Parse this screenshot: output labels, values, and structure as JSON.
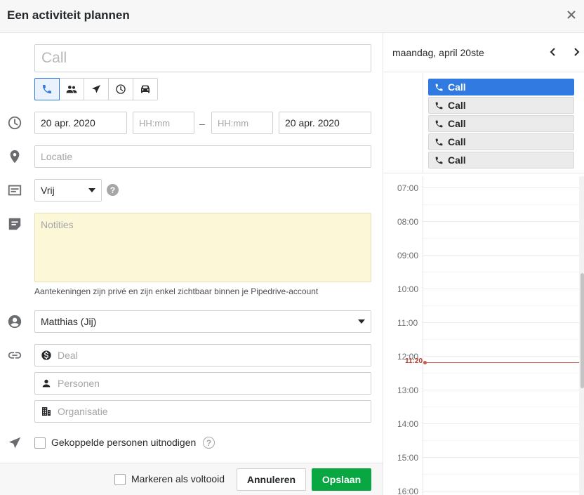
{
  "header": {
    "title": "Een activiteit plannen"
  },
  "form": {
    "subject_placeholder": "Call",
    "activity_types": [
      "call-icon",
      "meeting-icon",
      "task-icon",
      "deadline-icon",
      "lunch-icon"
    ],
    "start_date": "20 apr. 2020",
    "start_time_placeholder": "HH:mm",
    "separator": "–",
    "end_time_placeholder": "HH:mm",
    "end_date": "20 apr. 2020",
    "location_placeholder": "Locatie",
    "availability": "Vrij",
    "help_mark": "?",
    "notes_placeholder": "Notities",
    "notes_hint": "Aantekeningen zijn privé en zijn enkel zichtbaar binnen je Pipedrive-account",
    "owner": "Matthias (Jij)",
    "deal_placeholder": "Deal",
    "persons_placeholder": "Personen",
    "organization_placeholder": "Organisatie",
    "invite_label": "Gekoppelde personen uitnodigen"
  },
  "footer": {
    "mark_done_label": "Markeren als voltooid",
    "cancel_label": "Annuleren",
    "save_label": "Opslaan"
  },
  "calendar": {
    "date_label": "maandag, april 20ste",
    "events": [
      {
        "label": "Call",
        "active": true
      },
      {
        "label": "Call",
        "active": false
      },
      {
        "label": "Call",
        "active": false
      },
      {
        "label": "Call",
        "active": false
      },
      {
        "label": "Call",
        "active": false
      }
    ],
    "hours": [
      "07:00",
      "08:00",
      "09:00",
      "10:00",
      "11:00",
      "12:00",
      "13:00",
      "14:00",
      "15:00",
      "16:00"
    ],
    "now_label": "11:20"
  },
  "colors": {
    "primary": "#08a742",
    "accent": "#317ae2",
    "notes_bg": "#fcf7d6",
    "now_line": "#c45a4c"
  }
}
